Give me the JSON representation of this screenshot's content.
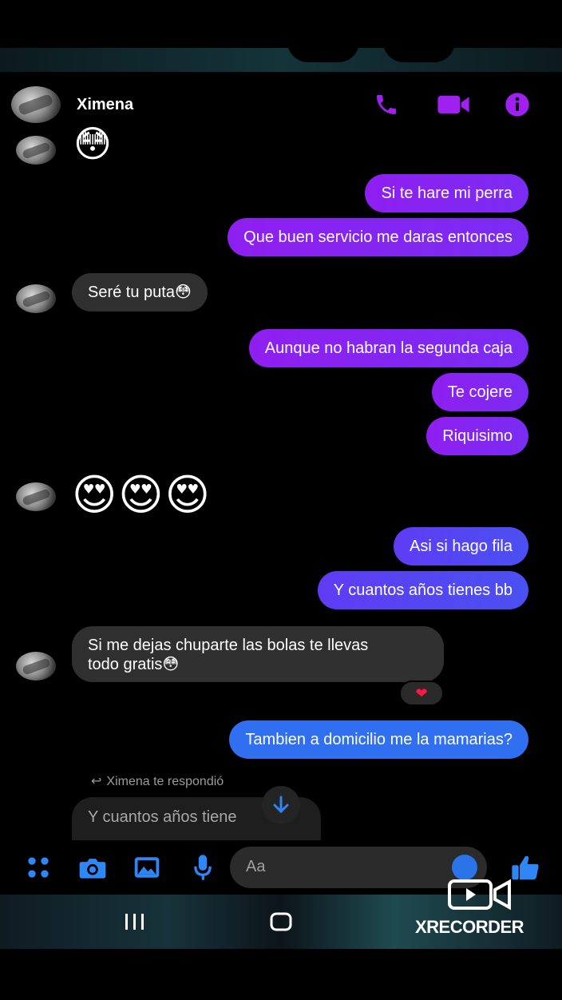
{
  "header": {
    "contact_name": "Ximena"
  },
  "messages": [
    {
      "side": "out",
      "text": "Si te hare mi perra"
    },
    {
      "side": "out",
      "text": "Que buen servicio me daras entonces"
    },
    {
      "side": "in",
      "text": "Seré tu puta😳"
    },
    {
      "side": "out",
      "text": "Aunque no habran la segunda caja"
    },
    {
      "side": "out",
      "text": "Te cojere"
    },
    {
      "side": "out",
      "text": "Riquisimo"
    },
    {
      "side": "in",
      "text": "😍😍😍"
    },
    {
      "side": "out",
      "text": "Asi si hago fila"
    },
    {
      "side": "out",
      "text": "Y cuantos años tienes bb"
    },
    {
      "side": "in",
      "line1": "Si me dejas chuparte las bolas te llevas",
      "line2": "todo gratis😳"
    },
    {
      "side": "out",
      "text": "Tambien a domicilio me la mamarias?"
    }
  ],
  "top_emoji": "😳",
  "reaction": "❤",
  "reply": {
    "label": "Ximena te respondió",
    "quoted_text": "Y cuantos años tiene"
  },
  "composer": {
    "placeholder": "Aa"
  },
  "watermark": {
    "text": "XRECORDER"
  },
  "colors": {
    "accent_purple": "#9b1ff5",
    "accent_blue": "#2f6ff0",
    "incoming_bubble": "#303030"
  }
}
